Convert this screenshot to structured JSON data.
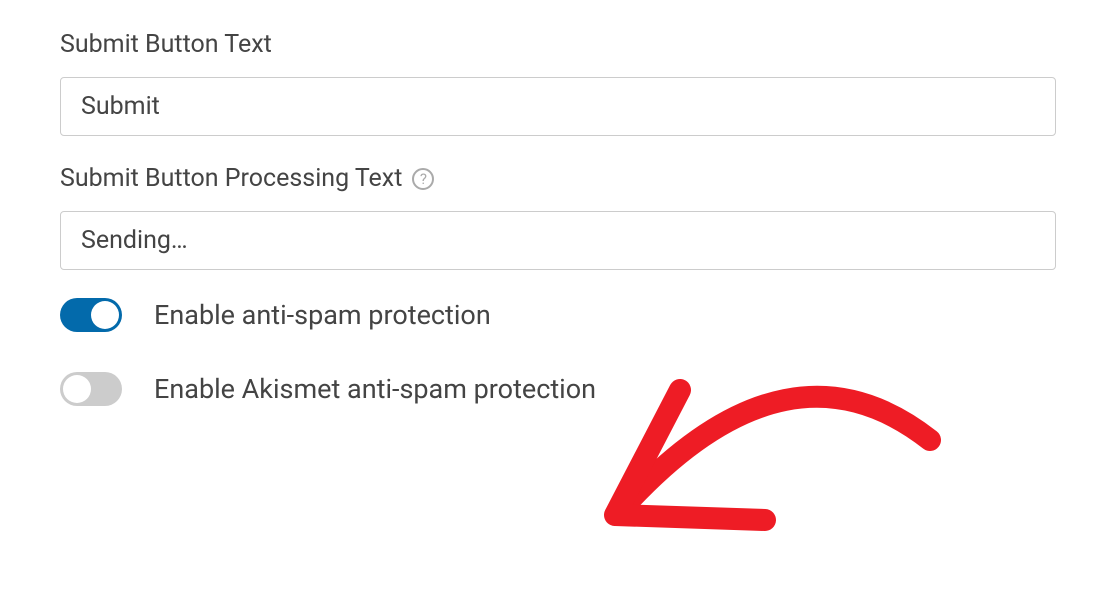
{
  "fields": {
    "submit_text": {
      "label": "Submit Button Text",
      "value": "Submit"
    },
    "processing_text": {
      "label": "Submit Button Processing Text",
      "value": "Sending…"
    }
  },
  "toggles": {
    "anti_spam": {
      "label": "Enable anti-spam protection",
      "enabled": true
    },
    "akismet": {
      "label": "Enable Akismet anti-spam protection",
      "enabled": false
    }
  },
  "help_icon_glyph": "?"
}
